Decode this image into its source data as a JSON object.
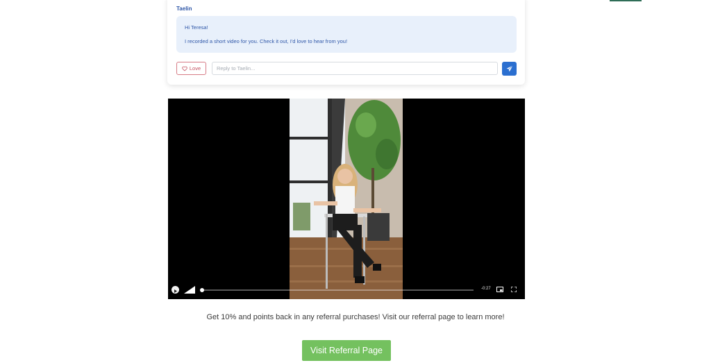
{
  "message": {
    "sender": "Taelin",
    "greeting": "Hi Teresa!",
    "body": "I recorded a short video for you. Check it out, I'd love to hear from you!",
    "love_label": "Love",
    "reply_placeholder": "Reply to Taelin..."
  },
  "video": {
    "time_display": "-0:27",
    "progress_fraction": 0.005
  },
  "promo": {
    "text": "Get 10% and points back in any referral purchases! Visit our referral page to learn more!",
    "button_label": "Visit Referral Page"
  },
  "icons": {
    "love": "heart-icon",
    "send": "send-icon",
    "play": "play-icon",
    "volume": "volume-icon",
    "pip": "picture-in-picture-icon",
    "fullscreen": "fullscreen-icon"
  },
  "colors": {
    "accent_blue": "#2b6fd0",
    "bubble_bg": "#e8f0fb",
    "love_red": "#c24d5d",
    "cta_green": "#74c15f"
  }
}
